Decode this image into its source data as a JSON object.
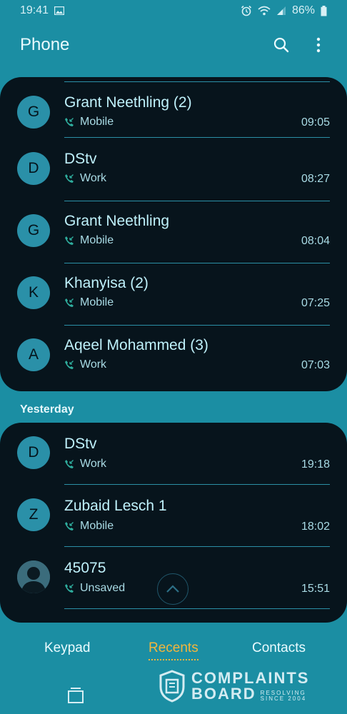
{
  "status_bar": {
    "time": "19:41",
    "battery": "86%"
  },
  "header": {
    "title": "Phone"
  },
  "calls_today": [
    {
      "initial": "G",
      "name": "Grant Neethling (2)",
      "type": "Mobile",
      "time": "09:05"
    },
    {
      "initial": "D",
      "name": "DStv",
      "type": "Work",
      "time": "08:27"
    },
    {
      "initial": "G",
      "name": "Grant Neethling",
      "type": "Mobile",
      "time": "08:04"
    },
    {
      "initial": "K",
      "name": "Khanyisa (2)",
      "type": "Mobile",
      "time": "07:25"
    },
    {
      "initial": "A",
      "name": "Aqeel Mohammed (3)",
      "type": "Work",
      "time": "07:03"
    }
  ],
  "section_yesterday": "Yesterday",
  "calls_yesterday": [
    {
      "initial": "D",
      "name": "DStv",
      "type": "Work",
      "time": "19:18"
    },
    {
      "initial": "Z",
      "name": "Zubaid Lesch 1",
      "type": "Mobile",
      "time": "18:02"
    },
    {
      "initial": "",
      "name": "45075",
      "type": "Unsaved",
      "time": "15:51"
    }
  ],
  "tabs": {
    "keypad": "Keypad",
    "recents": "Recents",
    "contacts": "Contacts"
  },
  "watermark": {
    "line1": "COMPLAINTS",
    "line2": "BOARD",
    "small1": "RESOLVING",
    "small2": "SINCE 2004"
  },
  "colors": {
    "background": "#1b8ea3",
    "card": "#07141c",
    "accent": "#f2b63d"
  }
}
